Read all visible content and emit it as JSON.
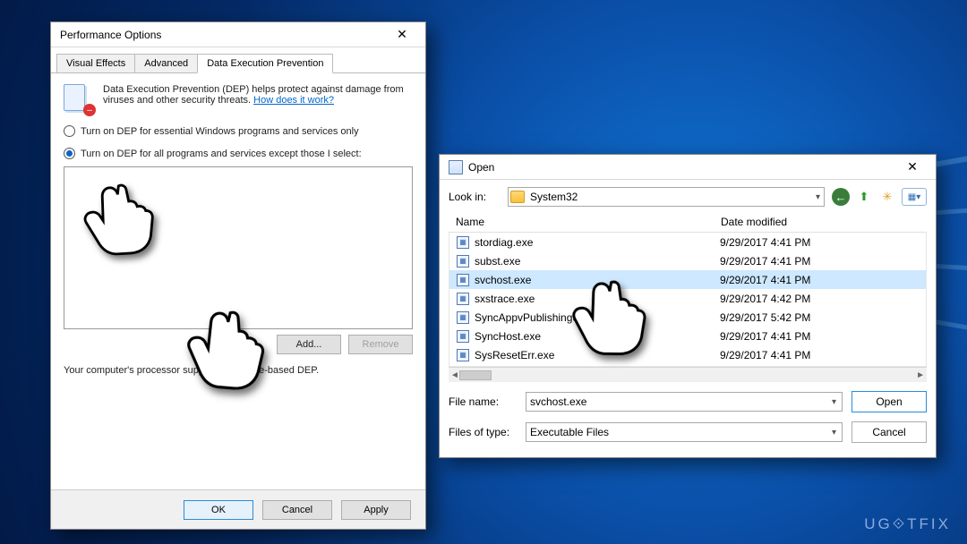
{
  "watermark": "UG⟐TFIX",
  "perf": {
    "title": "Performance Options",
    "tabs": {
      "t0": "Visual Effects",
      "t1": "Advanced",
      "t2": "Data Execution Prevention"
    },
    "desc": "Data Execution Prevention (DEP) helps protect against damage from viruses and other security threats. ",
    "link": "How does it work?",
    "radio1": "Turn on DEP for essential Windows programs and services only",
    "radio2": "Turn on DEP for all programs and services except those I select:",
    "add": "Add...",
    "remove": "Remove",
    "note": "Your computer's processor supports hardware-based DEP.",
    "ok": "OK",
    "cancel": "Cancel",
    "apply": "Apply"
  },
  "open": {
    "title": "Open",
    "lookin_label": "Look in:",
    "folder": "System32",
    "col_name": "Name",
    "col_date": "Date modified",
    "files": [
      {
        "name": "stordiag.exe",
        "date": "9/29/2017 4:41 PM"
      },
      {
        "name": "subst.exe",
        "date": "9/29/2017 4:41 PM"
      },
      {
        "name": "svchost.exe",
        "date": "9/29/2017 4:41 PM"
      },
      {
        "name": "sxstrace.exe",
        "date": "9/29/2017 4:42 PM"
      },
      {
        "name": "SyncAppvPublishingServer.exe",
        "date": "9/29/2017 5:42 PM"
      },
      {
        "name": "SyncHost.exe",
        "date": "9/29/2017 4:41 PM"
      },
      {
        "name": "SysResetErr.exe",
        "date": "9/29/2017 4:41 PM"
      }
    ],
    "filename_label": "File name:",
    "filename_value": "svchost.exe",
    "filetype_label": "Files of type:",
    "filetype_value": "Executable Files",
    "open_btn": "Open",
    "cancel_btn": "Cancel"
  }
}
